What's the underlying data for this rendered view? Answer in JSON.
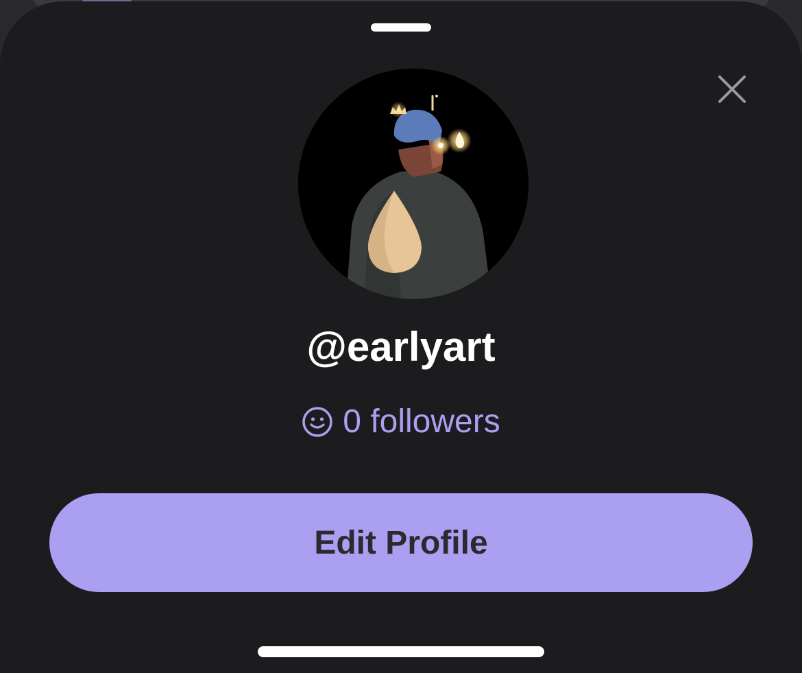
{
  "profile": {
    "username": "@earlyart",
    "followers_text": "0 followers"
  },
  "actions": {
    "edit_profile_label": "Edit Profile"
  },
  "icons": {
    "close": "close-icon",
    "followers": "smiley-icon"
  },
  "colors": {
    "accent": "#aa9ff0",
    "sheet_background": "#1c1c1e",
    "button_text": "#2a2a30"
  }
}
